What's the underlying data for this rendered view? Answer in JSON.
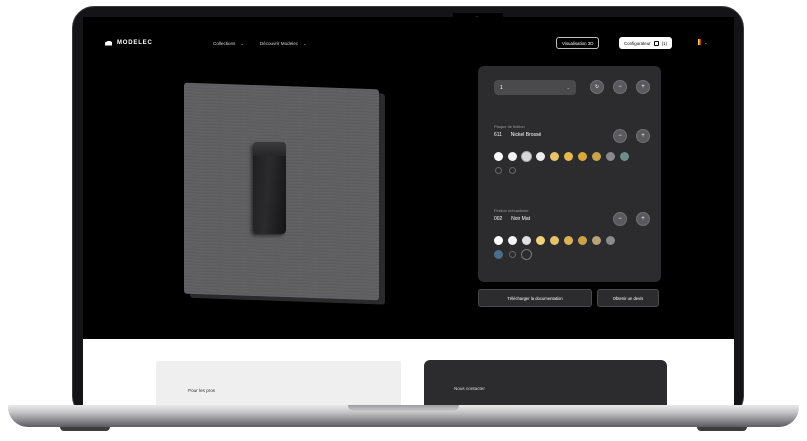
{
  "nav": {
    "brand": "MODELEC",
    "menu": [
      {
        "label": "Collections",
        "icon": "chevron-down-icon"
      },
      {
        "label": "Découvrir Modelec",
        "icon": "chevron-down-icon"
      }
    ],
    "visualisation_label": "Visualisation 3D",
    "configurateur_label": "Configurateur",
    "cart_count": "(1)",
    "language": "FR"
  },
  "config": {
    "select_value": "1",
    "select_icon": "chevron-down-icon",
    "plate_section": {
      "label": "Plaque de finition",
      "code": "611",
      "name": "Nickel Brossé"
    },
    "mechanism_section": {
      "label": "Finition mécanisme",
      "code": "002",
      "name": "Noir Mat"
    },
    "plate_swatches": [
      "#ffffff",
      "#f2f2f2",
      "#d8d8d8",
      "#e9c46a",
      "#e6b84e",
      "#d8a93a",
      "#c9a24a",
      "#8a8a8a",
      "#6b8e8a"
    ],
    "mechanism_swatches": [
      "#ffffff",
      "#f4f4f4",
      "#e0e0e0",
      "#efd27a",
      "#e6c36a",
      "#dcb258",
      "#c9a24a",
      "#b8a27a",
      "#8a8a8a",
      "#4a6f8a"
    ],
    "accent": "#2c2c2e"
  },
  "actions": {
    "download_label": "Télécharger la documentation",
    "devis_label": "Obtenir un devis"
  },
  "lower": {
    "left_title": "Pour les pros",
    "right_title": "Nous contacter"
  }
}
